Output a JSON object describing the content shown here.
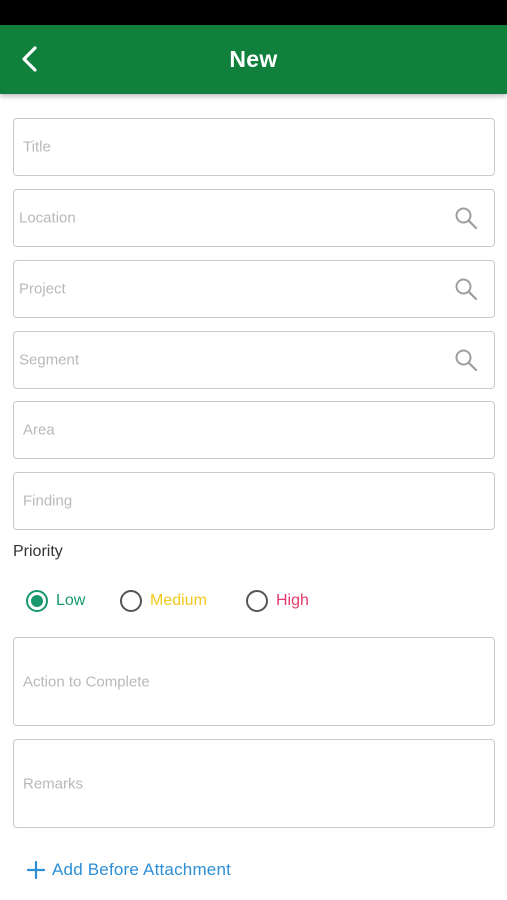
{
  "header": {
    "title": "New",
    "back_icon": "chevron-left-icon"
  },
  "fields": {
    "title": {
      "placeholder": "Title",
      "value": ""
    },
    "location": {
      "placeholder": "Location",
      "value": "",
      "icon": "search-icon"
    },
    "project": {
      "placeholder": "Project",
      "value": "",
      "icon": "search-icon"
    },
    "segment": {
      "placeholder": "Segment",
      "value": "",
      "icon": "search-icon"
    },
    "area": {
      "placeholder": "Area",
      "value": ""
    },
    "finding": {
      "placeholder": "Finding",
      "value": ""
    },
    "action": {
      "placeholder": "Action to Complete",
      "value": ""
    },
    "remarks": {
      "placeholder": "Remarks",
      "value": ""
    }
  },
  "priority": {
    "label": "Priority",
    "selected": "Low",
    "options": [
      {
        "label": "Low",
        "color": "#19996b",
        "checked": true
      },
      {
        "label": "Medium",
        "color": "#f2c81d",
        "checked": false
      },
      {
        "label": "High",
        "color": "#e0396b",
        "checked": false
      }
    ]
  },
  "attachment": {
    "label": "Add Before Attachment",
    "icon": "plus-icon",
    "color": "#2d8fd6"
  },
  "colors": {
    "app_bar": "#10803c",
    "status_bar": "#000000",
    "border": "#c9c9c9",
    "placeholder": "#b9b9b9"
  }
}
